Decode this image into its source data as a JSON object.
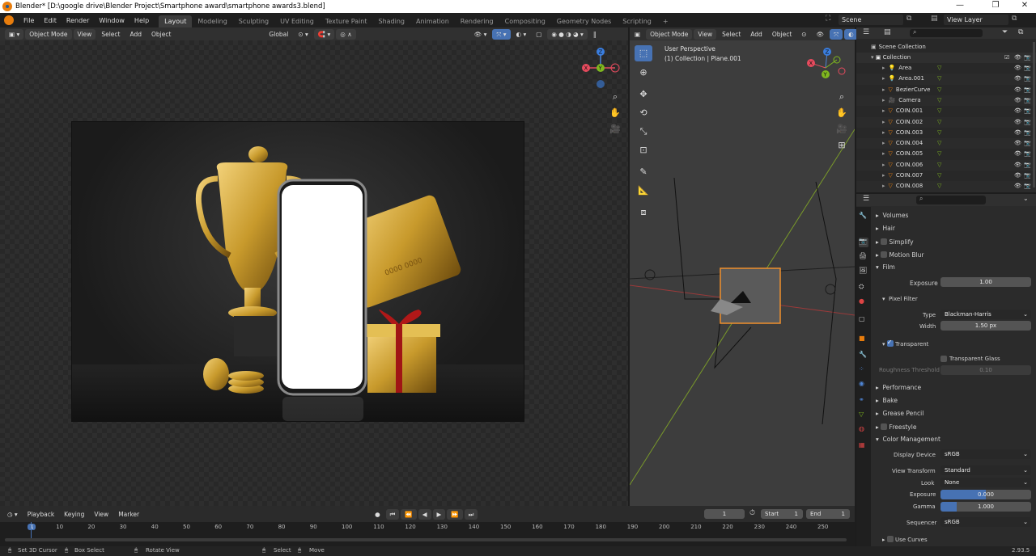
{
  "window": {
    "title": "Blender* [D:\\google drive\\Blender Project\\Smartphone award\\smartphone awards3.blend]",
    "minimize": "—",
    "maximize": "❐",
    "close": "✕"
  },
  "menu": [
    "File",
    "Edit",
    "Render",
    "Window",
    "Help"
  ],
  "workspaces": [
    "Layout",
    "Modeling",
    "Sculpting",
    "UV Editing",
    "Texture Paint",
    "Shading",
    "Animation",
    "Rendering",
    "Compositing",
    "Geometry Nodes",
    "Scripting",
    "+"
  ],
  "scene": {
    "label": "Scene",
    "view_layer": "View Layer"
  },
  "viewport_left": {
    "mode": "Object Mode",
    "menus": [
      "View",
      "Select",
      "Add",
      "Object"
    ],
    "transform": "Global"
  },
  "viewport_right": {
    "mode": "Object Mode",
    "menus": [
      "View",
      "Select",
      "Add",
      "Object"
    ],
    "perspective": "User Perspective",
    "collection_info": "(1) Collection | Plane.001"
  },
  "render_image": {
    "card_number": "0000 0000"
  },
  "gizmo": {
    "x": "X",
    "y": "Y",
    "z": "Z"
  },
  "outliner": {
    "root": "Scene Collection",
    "collection": "Collection",
    "items": [
      "Area",
      "Area.001",
      "BezierCurve",
      "Camera",
      "COIN.001",
      "COIN.002",
      "COIN.003",
      "COIN.004",
      "COIN.005",
      "COIN.006",
      "COIN.007",
      "COIN.008"
    ]
  },
  "properties": {
    "volumes": "Volumes",
    "hair": "Hair",
    "simplify": "Simplify",
    "motion_blur": "Motion Blur",
    "film": "Film",
    "exposure_label": "Exposure",
    "exposure_value": "1.00",
    "pixel_filter": "Pixel Filter",
    "type_label": "Type",
    "type_value": "Blackman-Harris",
    "width_label": "Width",
    "width_value": "1.50 px",
    "transparent": "Transparent",
    "transparent_glass": "Transparent Glass",
    "roughness_label": "Roughness Threshold",
    "roughness_value": "0.10",
    "performance": "Performance",
    "bake": "Bake",
    "grease_pencil": "Grease Pencil",
    "freestyle": "Freestyle",
    "color_management": "Color Management",
    "display_device_label": "Display Device",
    "display_device_value": "sRGB",
    "view_transform_label": "View Transform",
    "view_transform_value": "Standard",
    "look_label": "Look",
    "look_value": "None",
    "cm_exposure_label": "Exposure",
    "cm_exposure_value": "0.000",
    "gamma_label": "Gamma",
    "gamma_value": "1.000",
    "sequencer_label": "Sequencer",
    "sequencer_value": "sRGB",
    "use_curves": "Use Curves"
  },
  "timeline": {
    "menus": [
      "Playback",
      "Keying",
      "View",
      "Marker"
    ],
    "current_frame": "1",
    "start_label": "Start",
    "start_value": "1",
    "end_label": "End",
    "end_value": "1",
    "ruler": [
      "1",
      "10",
      "20",
      "30",
      "40",
      "50",
      "60",
      "70",
      "80",
      "90",
      "100",
      "110",
      "120",
      "130",
      "140",
      "150",
      "160",
      "170",
      "180",
      "190",
      "200",
      "210",
      "220",
      "230",
      "240",
      "250"
    ]
  },
  "status": {
    "set_cursor": "Set 3D Cursor",
    "box_select": "Box Select",
    "rotate_view": "Rotate View",
    "select": "Select",
    "move": "Move",
    "version": "2.93.5"
  }
}
